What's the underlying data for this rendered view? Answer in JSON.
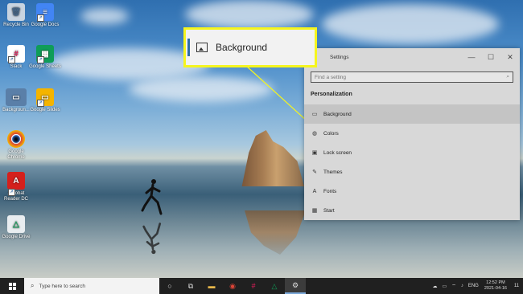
{
  "desktop_icons": [
    {
      "label": "Recycle Bin",
      "icon": "recycle-bin-icon",
      "color": "#c8d4e0",
      "symbol": "🗑"
    },
    {
      "label": "Google Docs",
      "icon": "google-docs-icon",
      "color": "#4285f4",
      "symbol": "≡"
    },
    {
      "label": "Slack",
      "icon": "slack-icon",
      "color": "#ffffff",
      "symbol": "#"
    },
    {
      "label": "Google Sheets",
      "icon": "google-sheets-icon",
      "color": "#0f9d58",
      "symbol": "▦"
    },
    {
      "label": "Backgroun...",
      "icon": "background-image-icon",
      "color": "#5a7fa8",
      "symbol": "▭"
    },
    {
      "label": "Google Slides",
      "icon": "google-slides-icon",
      "color": "#f4b400",
      "symbol": "▭"
    },
    {
      "label": "Google Chrome",
      "icon": "chrome-icon",
      "color": "#ffffff",
      "symbol": "◉"
    },
    {
      "label": "Acrobat Reader DC",
      "icon": "acrobat-icon",
      "color": "#d4201c",
      "symbol": "A"
    },
    {
      "label": "Google Drive",
      "icon": "google-drive-icon",
      "color": "#e9edf0",
      "symbol": "△"
    }
  ],
  "callout": {
    "label": "Background"
  },
  "settings": {
    "title": "Settings",
    "search_placeholder": "Find a setting",
    "section": "Personalization",
    "items": [
      {
        "label": "Background",
        "icon": "background-icon",
        "symbol": "▭",
        "active": true
      },
      {
        "label": "Colors",
        "icon": "palette-icon",
        "symbol": "◍",
        "active": false
      },
      {
        "label": "Lock screen",
        "icon": "lock-screen-icon",
        "symbol": "▣",
        "active": false
      },
      {
        "label": "Themes",
        "icon": "themes-icon",
        "symbol": "✎",
        "active": false
      },
      {
        "label": "Fonts",
        "icon": "fonts-icon",
        "symbol": "A",
        "active": false
      },
      {
        "label": "Start",
        "icon": "start-icon",
        "symbol": "▦",
        "active": false
      }
    ],
    "window_buttons": {
      "minimize": "—",
      "maximize": "☐",
      "close": "✕"
    }
  },
  "taskbar": {
    "search_placeholder": "Type here to search",
    "tray_lang": "ENG",
    "time": "12:52 PM",
    "date": "2021-04-16",
    "notification_count": "11"
  }
}
